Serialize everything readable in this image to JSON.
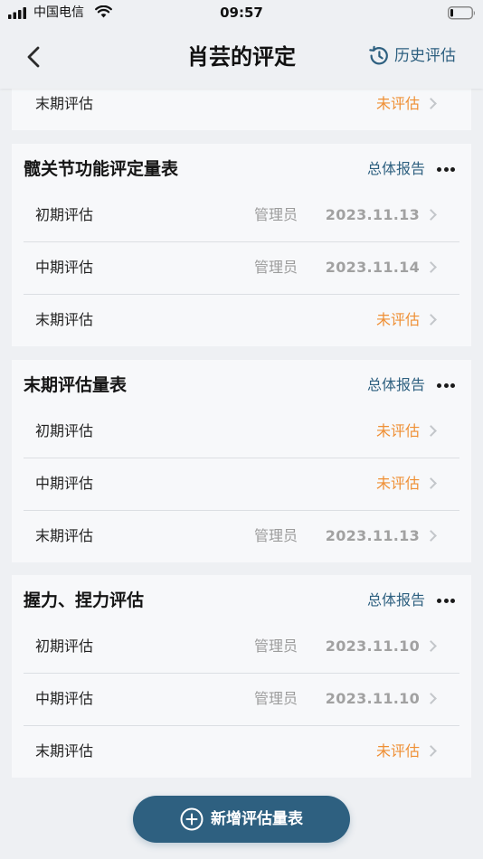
{
  "status_bar": {
    "carrier": "中国电信",
    "time": "09:57"
  },
  "nav": {
    "title": "肖芸的评定",
    "history_label": "历史评估"
  },
  "partial_card": {
    "rows": [
      {
        "label": "末期评估",
        "status": "未评估"
      }
    ]
  },
  "cards": [
    {
      "title": "髋关节功能评定量表",
      "report_label": "总体报告",
      "rows": [
        {
          "label": "初期评估",
          "assessor": "管理员",
          "date": "2023.11.13"
        },
        {
          "label": "中期评估",
          "assessor": "管理员",
          "date": "2023.11.14"
        },
        {
          "label": "末期评估",
          "status": "未评估"
        }
      ]
    },
    {
      "title": "末期评估量表",
      "report_label": "总体报告",
      "rows": [
        {
          "label": "初期评估",
          "status": "未评估"
        },
        {
          "label": "中期评估",
          "status": "未评估"
        },
        {
          "label": "末期评估",
          "assessor": "管理员",
          "date": "2023.11.13"
        }
      ]
    },
    {
      "title": "握力、捏力评估",
      "report_label": "总体报告",
      "rows": [
        {
          "label": "初期评估",
          "assessor": "管理员",
          "date": "2023.11.10"
        },
        {
          "label": "中期评估",
          "assessor": "管理员",
          "date": "2023.11.10"
        },
        {
          "label": "末期评估",
          "status": "未评估"
        }
      ]
    }
  ],
  "add_button": {
    "label": "新增评估量表"
  },
  "colors": {
    "accent": "#2e6080",
    "pending": "#ef8f34",
    "muted_text": "#9c9c9c",
    "page_background": "#eef0f3",
    "card_background": "#f7f8fa"
  },
  "icons": {
    "signal": "cellular-signal-icon",
    "wifi": "wifi-icon",
    "battery": "battery-icon",
    "back": "chevron-left-icon",
    "history": "history-icon",
    "more": "more-dots-icon",
    "row_arrow": "chevron-right-icon",
    "add": "plus-circle-icon"
  }
}
